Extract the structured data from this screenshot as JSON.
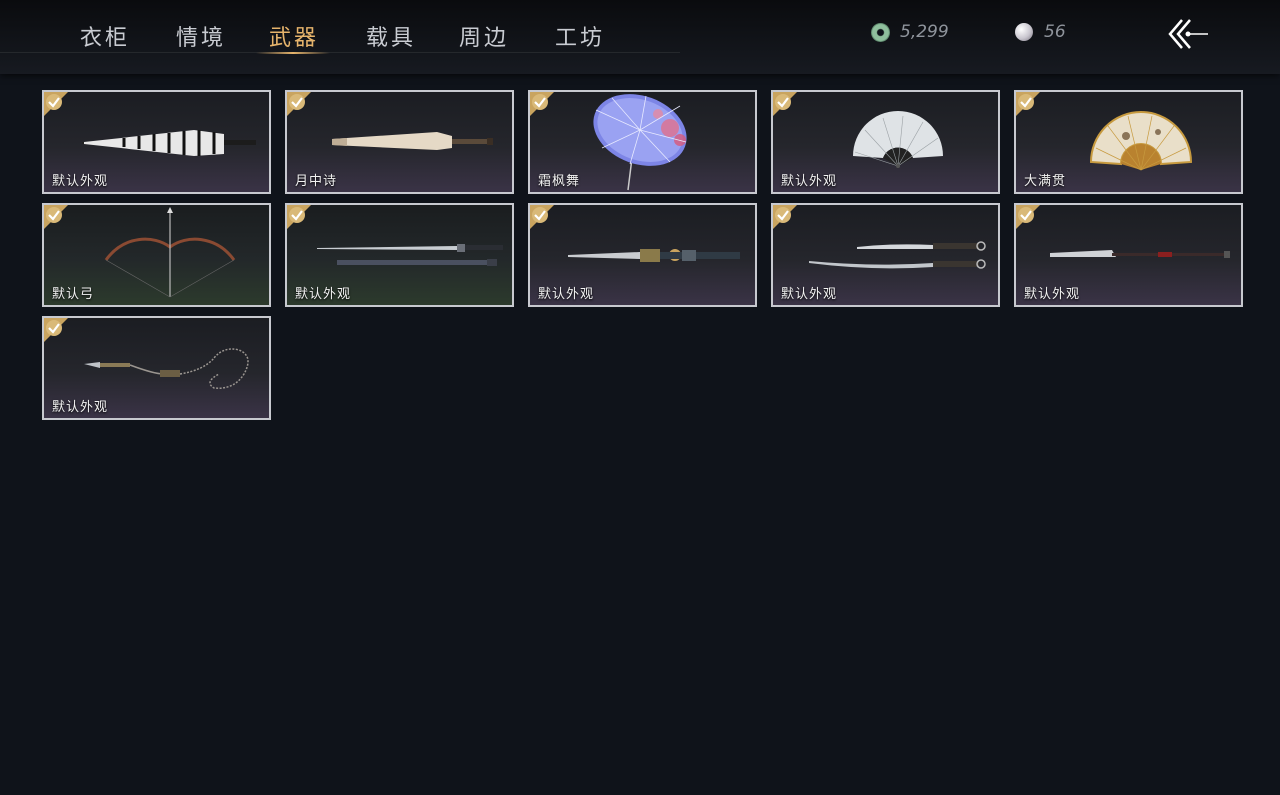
{
  "tabs": [
    {
      "label": "衣柜"
    },
    {
      "label": "情境"
    },
    {
      "label": "武器"
    },
    {
      "label": "载具"
    },
    {
      "label": "周边"
    },
    {
      "label": "工坊"
    }
  ],
  "active_tab": "武器",
  "currencies": {
    "jade_coin": "5,299",
    "pearl": "56"
  },
  "colors": {
    "accent": "#e6b46c",
    "background": "#0f131a",
    "card_border": "#c7c9cf",
    "check_badge": "#c9a45f"
  },
  "items": [
    {
      "label": "默认外观",
      "icon": "striped-umbrella-icon"
    },
    {
      "label": "月中诗",
      "icon": "paper-umbrella-icon"
    },
    {
      "label": "霜枫舞",
      "icon": "open-umbrella-icon"
    },
    {
      "label": "默认外观",
      "icon": "folding-fan-icon"
    },
    {
      "label": "大满贯",
      "icon": "golden-fan-icon"
    },
    {
      "label": "默认弓",
      "icon": "bow-icon"
    },
    {
      "label": "默认外观",
      "icon": "sword-and-scabbard-icon"
    },
    {
      "label": "默认外观",
      "icon": "ornate-sword-icon"
    },
    {
      "label": "默认外观",
      "icon": "twin-sabres-icon"
    },
    {
      "label": "默认外观",
      "icon": "glaive-icon"
    },
    {
      "label": "默认外观",
      "icon": "rope-dart-icon"
    }
  ]
}
